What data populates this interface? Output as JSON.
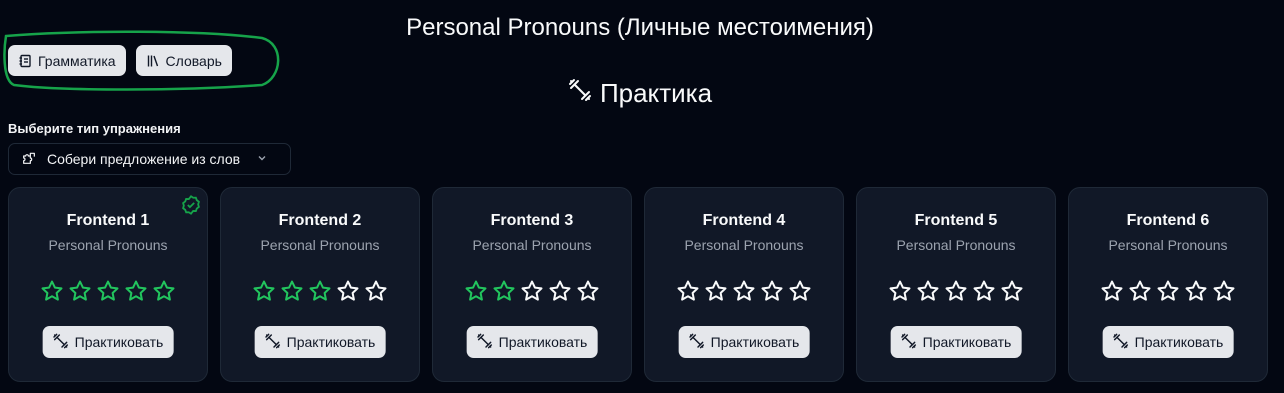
{
  "page_title": "Personal Pronouns (Личные местоимения)",
  "nav": {
    "grammar_label": "Грамматика",
    "grammar_icon": "notebook-icon",
    "dictionary_label": "Словарь",
    "dictionary_icon": "library-icon",
    "highlight_color": "#16a34a"
  },
  "section": {
    "title": "Практика",
    "icon": "dumbbell-icon"
  },
  "exercise_type": {
    "label": "Выберите тип упражнения",
    "selected": "Собери предложение из слов",
    "icon": "puzzle-icon"
  },
  "colors": {
    "star_filled": "#22c55e",
    "star_empty": "#f9fafb",
    "completed_badge": "#16a34a"
  },
  "cards": [
    {
      "title": "Frontend 1",
      "subtitle": "Personal Pronouns",
      "stars_filled": 5,
      "stars_total": 5,
      "completed": true,
      "button_label": "Практиковать"
    },
    {
      "title": "Frontend 2",
      "subtitle": "Personal Pronouns",
      "stars_filled": 3,
      "stars_total": 5,
      "completed": false,
      "button_label": "Практиковать"
    },
    {
      "title": "Frontend 3",
      "subtitle": "Personal Pronouns",
      "stars_filled": 2,
      "stars_total": 5,
      "completed": false,
      "button_label": "Практиковать"
    },
    {
      "title": "Frontend 4",
      "subtitle": "Personal Pronouns",
      "stars_filled": 0,
      "stars_total": 5,
      "completed": false,
      "button_label": "Практиковать"
    },
    {
      "title": "Frontend 5",
      "subtitle": "Personal Pronouns",
      "stars_filled": 0,
      "stars_total": 5,
      "completed": false,
      "button_label": "Практиковать"
    },
    {
      "title": "Frontend 6",
      "subtitle": "Personal Pronouns",
      "stars_filled": 0,
      "stars_total": 5,
      "completed": false,
      "button_label": "Практиковать"
    }
  ]
}
